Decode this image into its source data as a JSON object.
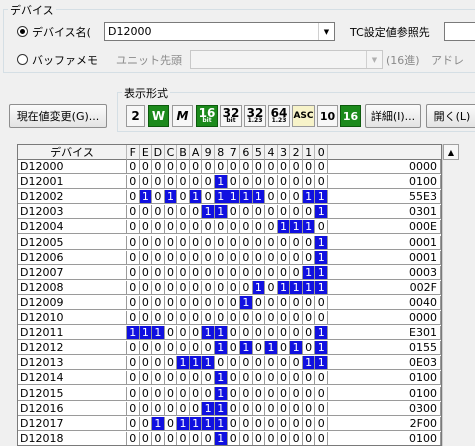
{
  "device_group": {
    "title": "デバイス",
    "device_name_label": "デバイス名(",
    "device_name_value": "D12000",
    "tc_label": "TC設定値参照先",
    "buffer_label": "バッファメモ",
    "unit_label": "ユニット先頭",
    "bit16_label": "(16進)",
    "address_label": "アドレ"
  },
  "buttons": {
    "change_value": "現在値変更(G)...",
    "details": "詳細(I)...",
    "open": "開く(L)"
  },
  "format_group": {
    "title": "表示形式",
    "btn_2": "2",
    "btn_w": "W",
    "btn_m": "M",
    "btn_16bit_top": "16",
    "btn_16bit_bottom": "bit",
    "btn_32bit_top": "32",
    "btn_32bit_bottom": "bit",
    "btn_32f_top": "32",
    "btn_32f_bottom": "1.23",
    "btn_64f_top": "64",
    "btn_64f_bottom": "1.23",
    "btn_asc": "ASC",
    "btn_10": "10",
    "btn_16": "16"
  },
  "table": {
    "header_device": "デバイス",
    "bit_headers": [
      "F",
      "E",
      "D",
      "C",
      "B",
      "A",
      "9",
      "8",
      "7",
      "6",
      "5",
      "4",
      "3",
      "2",
      "1",
      "0"
    ],
    "rows": [
      {
        "device": "D12000",
        "bits": "0000000000000000",
        "hex": "0000"
      },
      {
        "device": "D12001",
        "bits": "0000000100000000",
        "hex": "0100"
      },
      {
        "device": "D12002",
        "bits": "0101010111100011",
        "hex": "55E3"
      },
      {
        "device": "D12003",
        "bits": "0000001100000001",
        "hex": "0301"
      },
      {
        "device": "D12004",
        "bits": "0000000000001110",
        "hex": "000E"
      },
      {
        "device": "D12005",
        "bits": "0000000000000001",
        "hex": "0001"
      },
      {
        "device": "D12006",
        "bits": "0000000000000001",
        "hex": "0001"
      },
      {
        "device": "D12007",
        "bits": "0000000000000011",
        "hex": "0003"
      },
      {
        "device": "D12008",
        "bits": "0000000000101111",
        "hex": "002F"
      },
      {
        "device": "D12009",
        "bits": "0000000001000000",
        "hex": "0040"
      },
      {
        "device": "D12010",
        "bits": "0000000000000000",
        "hex": "0000"
      },
      {
        "device": "D12011",
        "bits": "1110001100000001",
        "hex": "E301"
      },
      {
        "device": "D12012",
        "bits": "0000000101010101",
        "hex": "0155"
      },
      {
        "device": "D12013",
        "bits": "0000111000000011",
        "hex": "0E03"
      },
      {
        "device": "D12014",
        "bits": "0000000100000000",
        "hex": "0100"
      },
      {
        "device": "D12015",
        "bits": "0000000100000000",
        "hex": "0100"
      },
      {
        "device": "D12016",
        "bits": "0000001100000000",
        "hex": "0300"
      },
      {
        "device": "D12017",
        "bits": "0010111100000000",
        "hex": "2F00"
      },
      {
        "device": "D12018",
        "bits": "0000000100000000",
        "hex": "0100"
      }
    ]
  },
  "colors": {
    "bit_on": "#1010e0",
    "format_active": "#1c8a1c"
  }
}
